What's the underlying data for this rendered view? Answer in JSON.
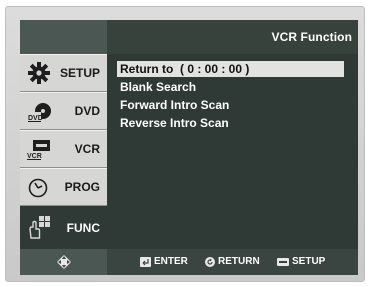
{
  "header": {
    "title": "VCR Function"
  },
  "sidebar": {
    "items": [
      {
        "label": "SETUP",
        "icon": "gear-icon"
      },
      {
        "label": "DVD",
        "icon": "dvd-icon",
        "sub": "DVD"
      },
      {
        "label": "VCR",
        "icon": "vcr-icon",
        "sub": "VCR"
      },
      {
        "label": "PROG",
        "icon": "clock-icon"
      },
      {
        "label": "FUNC",
        "icon": "hand-icon",
        "active": true
      }
    ]
  },
  "menu": {
    "items": [
      {
        "label": "Return to  ( 0 : 00 : 00 )",
        "selected": true
      },
      {
        "label": "Blank Search"
      },
      {
        "label": "Forward Intro Scan"
      },
      {
        "label": "Reverse Intro Scan"
      }
    ]
  },
  "footer": {
    "nav_icon": "navigation-arrows-icon",
    "enter_label": "ENTER",
    "return_label": "RETURN",
    "setup_label": "SETUP"
  },
  "colors": {
    "screen_bg": "#2f3a36",
    "sidebar_item_bg": "#d6d7d4",
    "highlight_bg": "#e2e2e0",
    "text": "#ffffff"
  }
}
